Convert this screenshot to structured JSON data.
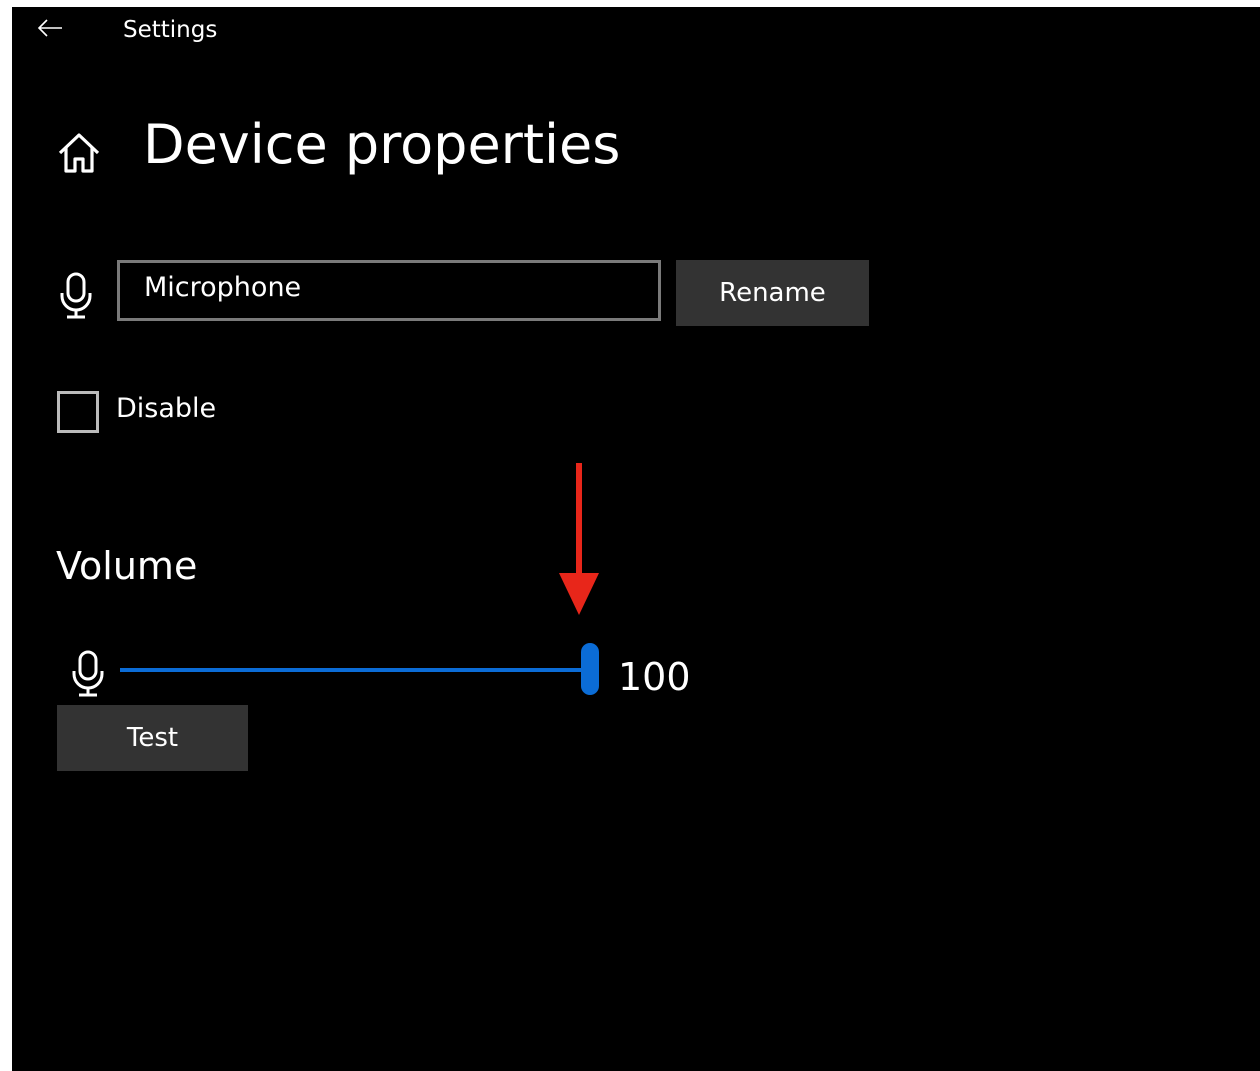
{
  "header": {
    "back_icon": "arrow-left-icon",
    "app_title": "Settings"
  },
  "page": {
    "home_icon": "home-icon",
    "title": "Device properties"
  },
  "device": {
    "icon": "microphone-icon",
    "name_value": "Microphone",
    "rename_label": "Rename"
  },
  "disable": {
    "label": "Disable",
    "checked": false
  },
  "volume": {
    "section_title": "Volume",
    "icon": "microphone-icon",
    "value": "100",
    "min": 0,
    "max": 100,
    "fill_percent": 100,
    "test_label": "Test"
  },
  "colors": {
    "background": "#000000",
    "accent": "#0b6cd6",
    "button_bg": "#333333",
    "annotation_arrow": "#e8261a"
  }
}
